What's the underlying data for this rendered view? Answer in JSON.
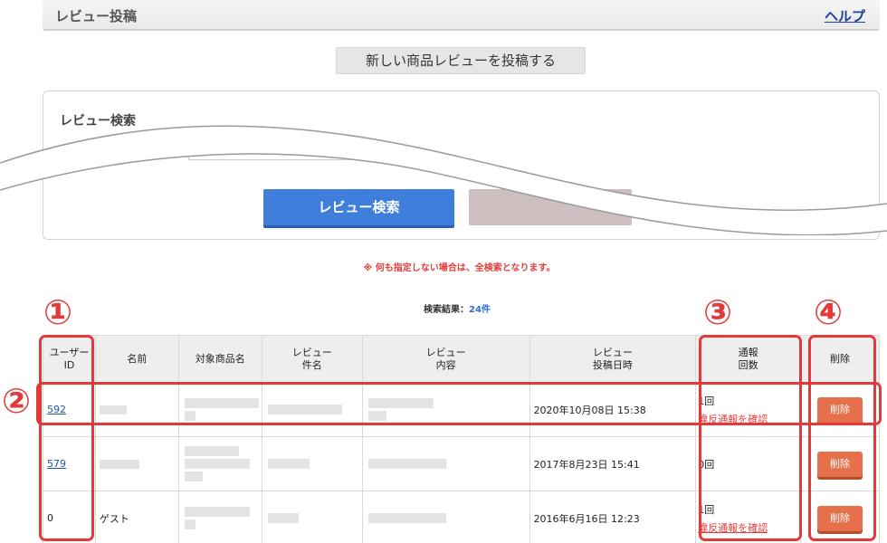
{
  "header": {
    "title": "レビュー投稿",
    "help": "ヘルプ"
  },
  "new_review_button": "新しい商品レビューを投稿する",
  "search": {
    "title": "レビュー検索",
    "button": "レビュー検索"
  },
  "notice": "※ 何も指定しない場合は、全検索となります。",
  "results": {
    "label": "検索結果：",
    "count": "24件"
  },
  "table": {
    "headers": {
      "user_id": [
        "ユーザー",
        "ID"
      ],
      "name": "名前",
      "product": "対象商品名",
      "title": [
        "レビュー",
        "件名"
      ],
      "body": [
        "レビュー",
        "内容"
      ],
      "date": [
        "レビュー",
        "投稿日時"
      ],
      "reports": [
        "通報",
        "回数"
      ],
      "delete": "削除"
    },
    "rows": [
      {
        "user_id": "592",
        "name": "",
        "date": "2020年10月08日 15:38",
        "reports": "1回",
        "report_link": "違反通報を確認",
        "delete": "削除"
      },
      {
        "user_id": "579",
        "name": "",
        "date": "2017年8月23日 15:41",
        "reports": "0回",
        "report_link": "",
        "delete": "削除"
      },
      {
        "user_id": "0",
        "name": "ゲスト",
        "date": "2016年6月16日 12:23",
        "reports": "1回",
        "report_link": "違反通報を確認",
        "delete": "削除"
      }
    ]
  },
  "annotations": {
    "a1": "①",
    "a2": "②",
    "a3": "③",
    "a4": "④"
  },
  "colors": {
    "accent_red": "#e23a3a",
    "search_blue": "#3f7fdb",
    "delete_orange": "#e6704b",
    "link_blue": "#2454a8"
  }
}
